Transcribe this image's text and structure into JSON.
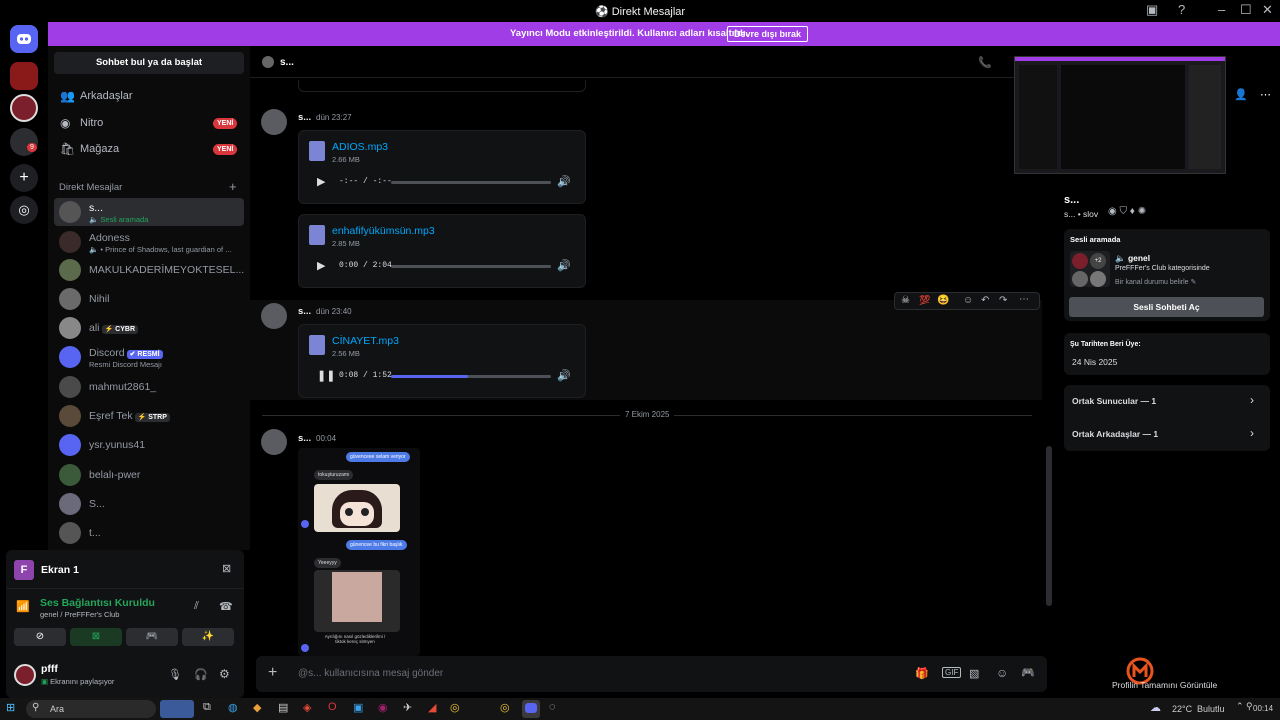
{
  "app": {
    "title": "Direkt Mesajlar",
    "logo_text": "F"
  },
  "banner": {
    "text": "Yayıncı Modu etkinleştirildi. Kullanıcı adları kısaltıldı.",
    "button": "Devre dışı bırak"
  },
  "guilds": {
    "unread_badge": "9"
  },
  "sidebar": {
    "search": "Sohbet bul ya da başlat",
    "nav": [
      {
        "label": "Arkadaşlar",
        "badge": ""
      },
      {
        "label": "Nitro",
        "badge": "YENİ"
      },
      {
        "label": "Mağaza",
        "badge": "YENİ"
      }
    ],
    "dm_header": "Direkt Mesajlar",
    "dms": [
      {
        "name": "s...",
        "sub": "🔈 Sesli aramada"
      },
      {
        "name": "Adoness",
        "sub": "🔈 • Prince of Shadows, last guardian of ..."
      },
      {
        "name": "MAKULKADERİMEYOKTESEL...",
        "sub": ""
      },
      {
        "name": "Nihil",
        "sub": ""
      },
      {
        "name": "ali",
        "tag": "⚡ CYBR",
        "sub": ""
      },
      {
        "name": "Discord",
        "tag": "✔ RESMİ",
        "sub": "Resmi Discord Mesajı"
      },
      {
        "name": "mahmut2861_",
        "sub": ""
      },
      {
        "name": "Eşref Tek",
        "tag": "⚡ STRP",
        "sub": ""
      },
      {
        "name": "ysr.yunus41",
        "sub": ""
      },
      {
        "name": "belalı-pwer",
        "sub": ""
      },
      {
        "name": "S...",
        "sub": ""
      },
      {
        "name": "t...",
        "sub": ""
      }
    ]
  },
  "screen": {
    "title": "Ekran 1"
  },
  "voice": {
    "status": "Ses Bağlantısı Kuruldu",
    "channel": "genel / PreFFFer's Club"
  },
  "user": {
    "name": "pfff",
    "status": "Ekranını paylaşıyor"
  },
  "chat": {
    "header_name": "s...",
    "messages": [
      {
        "author": "s...",
        "time": "dün 23:27",
        "file": "ADIOS.mp3",
        "size": "2.66 MB",
        "time_display": "-:-- / -:--",
        "progress": 0.0,
        "playing": false
      },
      {
        "author": "",
        "time": "",
        "file": "enhafifyükümsün.mp3",
        "size": "2.85 MB",
        "time_display": "0:00 / 2:04",
        "progress": 0.0,
        "playing": false
      },
      {
        "author": "s...",
        "time": "dün 23:40",
        "file": "CİNAYET.mp3",
        "size": "2.56 MB",
        "time_display": "0:08 / 1:52",
        "progress": 0.48,
        "playing": true
      }
    ],
    "date_divider": "7 Ekim 2025",
    "last_author": "s...",
    "last_time": "00:04",
    "bubbles": [
      "güvenceee selam veriyor",
      "tokuşturuzamı",
      "günencee bu fikri başlık",
      "Yeeeyyy",
      "Ayrılığını nasıl gözlediklerilmi / tiktok kereç sitmyen"
    ],
    "composer_placeholder": "@s... kullanıcısına mesaj gönder"
  },
  "profile": {
    "name": "s...",
    "handle": "s... • slov",
    "voice_title": "Sesli aramada",
    "voice_channel": "🔈 genel",
    "voice_server": "PreFFFer's Club kategorisinde",
    "voice_extra": "+2",
    "voice_status_hint": "Bir kanal durumu belirle",
    "voice_button": "Sesli Sohbeti Aç",
    "member_since_label": "Şu Tarihten Beri Üye:",
    "member_since": "24 Nis 2025",
    "mutual_servers": "Ortak Sunucular — 1",
    "mutual_friends": "Ortak Arkadaşlar — 1",
    "full_profile": "Profilin Tamamını Görüntüle"
  },
  "taskbar": {
    "search": "Ara",
    "weather": "22°C",
    "weather_text": "Bulutlu",
    "clock": "00:14"
  },
  "colors": {
    "banner": "#a03de6",
    "accent": "#5865f2",
    "link": "#00a8fc",
    "online": "#23a55a",
    "danger": "#da373c"
  }
}
